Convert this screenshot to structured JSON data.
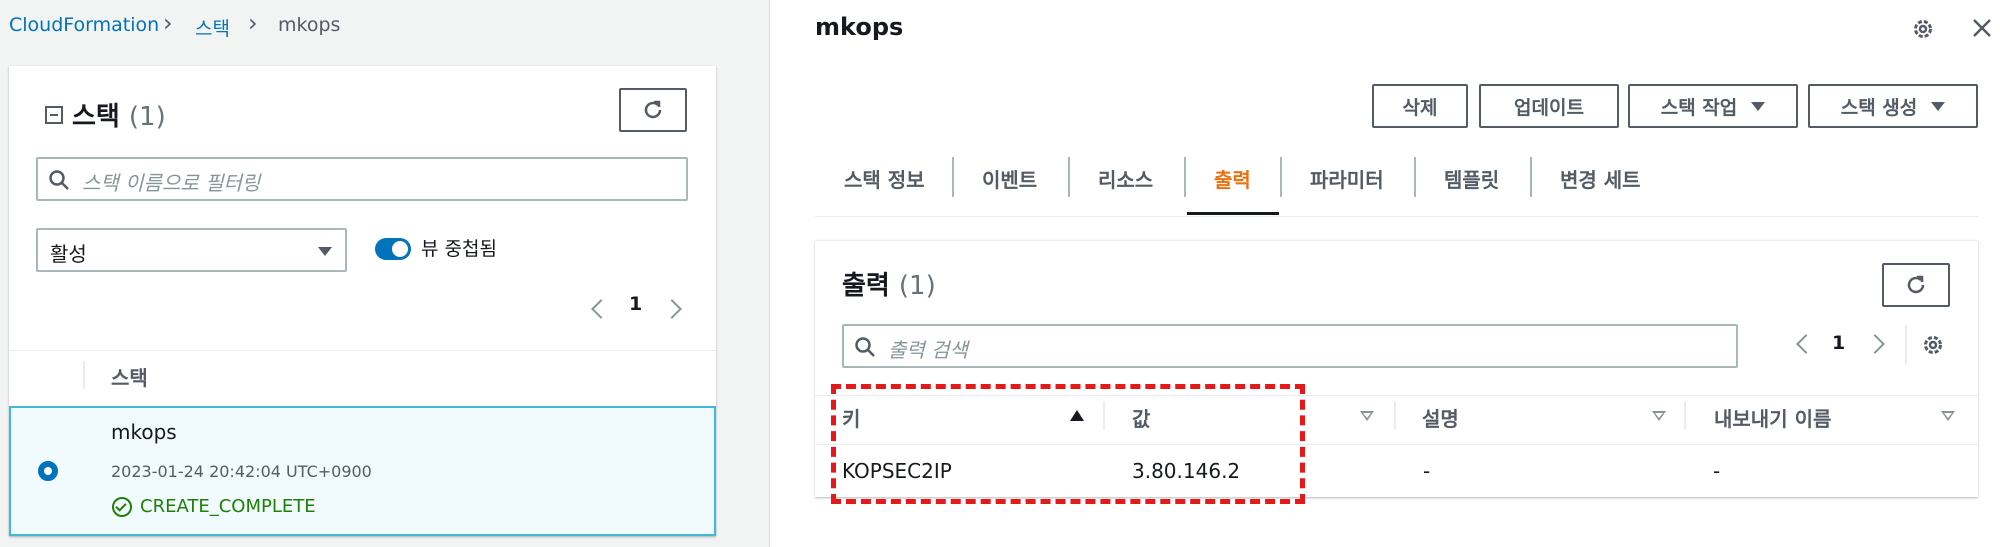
{
  "breadcrumb": {
    "root": "CloudFormation",
    "section": "스택",
    "current": "mkops"
  },
  "stacks_panel": {
    "title": "스택",
    "count": "(1)",
    "filter_placeholder": "스택 이름으로 필터링",
    "status_filter": "활성",
    "toggle_label": "뷰 중첩됨",
    "page": "1",
    "column_header": "스택",
    "selected_stack": {
      "name": "mkops",
      "created": "2023-01-24 20:42:04 UTC+0900",
      "status": "CREATE_COMPLETE"
    }
  },
  "detail": {
    "title": "mkops",
    "buttons": {
      "delete": "삭제",
      "update": "업데이트",
      "stack_actions": "스택 작업",
      "create_stack": "스택 생성"
    },
    "tabs": [
      "스택 정보",
      "이벤트",
      "리소스",
      "출력",
      "파라미터",
      "템플릿",
      "변경 세트"
    ],
    "active_tab": "출력",
    "outputs": {
      "title": "출력",
      "count": "(1)",
      "search_placeholder": "출력 검색",
      "page": "1",
      "columns": [
        "키",
        "값",
        "설명",
        "내보내기 이름"
      ],
      "rows": [
        {
          "key": "KOPSEC2IP",
          "value": "3.80.146.2",
          "description": "-",
          "export_name": "-"
        }
      ]
    }
  },
  "colors": {
    "link": "#0073bb",
    "active_tab": "#ec7211",
    "success": "#1d8102",
    "highlight_border": "#e61919",
    "selected_row_bg": "#f1faff"
  }
}
